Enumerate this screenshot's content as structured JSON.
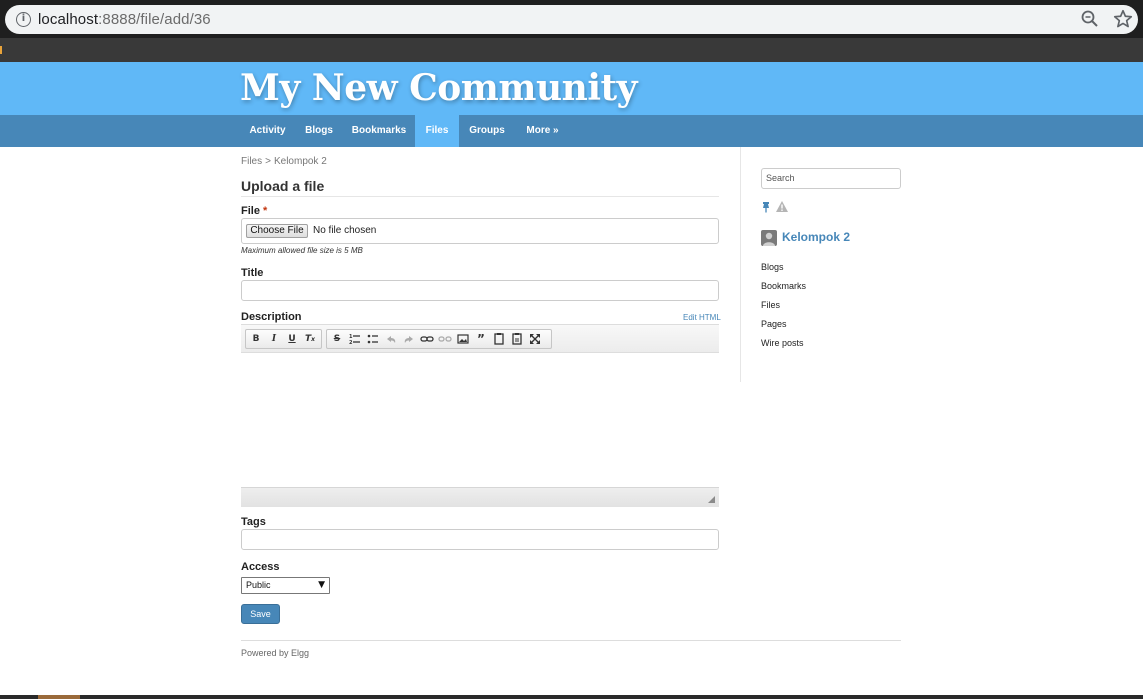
{
  "browser": {
    "url_host": "localhost",
    "url_path": ":8888/file/add/36"
  },
  "site": {
    "title": "My New Community",
    "nav": [
      {
        "label": "Activity"
      },
      {
        "label": "Blogs"
      },
      {
        "label": "Bookmarks"
      },
      {
        "label": "Files",
        "active": true
      },
      {
        "label": "Groups"
      },
      {
        "label": "More »"
      }
    ]
  },
  "breadcrumb": {
    "parent": "Files",
    "separator": ">",
    "current": "Kelompok 2"
  },
  "form": {
    "title": "Upload a file",
    "file_label": "File",
    "required_mark": "*",
    "choose_button": "Choose File",
    "no_file": "No file chosen",
    "file_hint": "Maximum allowed file size is 5 MB",
    "title_label": "Title",
    "title_value": "",
    "description_label": "Description",
    "edit_html": "Edit HTML",
    "tags_label": "Tags",
    "tags_value": "",
    "access_label": "Access",
    "access_value": "Public",
    "save_label": "Save"
  },
  "editor_toolbar": {
    "groups": [
      [
        "bold-icon",
        "italic-icon",
        "underline-icon",
        "remove-format-icon"
      ],
      [
        "strikethrough-icon",
        "numbered-list-icon",
        "bullet-list-icon",
        "undo-icon",
        "redo-icon",
        "link-icon",
        "unlink-icon",
        "image-icon",
        "blockquote-icon",
        "paste-icon",
        "paste-text-icon",
        "maximize-icon"
      ]
    ]
  },
  "sidebar": {
    "search_placeholder": "Search",
    "group_name": "Kelompok 2",
    "links": [
      "Blogs",
      "Bookmarks",
      "Files",
      "Pages",
      "Wire posts"
    ]
  },
  "footer": {
    "text": "Powered by Elgg"
  },
  "colors": {
    "header": "#60b8f7",
    "nav": "#4787b8",
    "accent": "#4787b8",
    "required": "#c2350e"
  }
}
